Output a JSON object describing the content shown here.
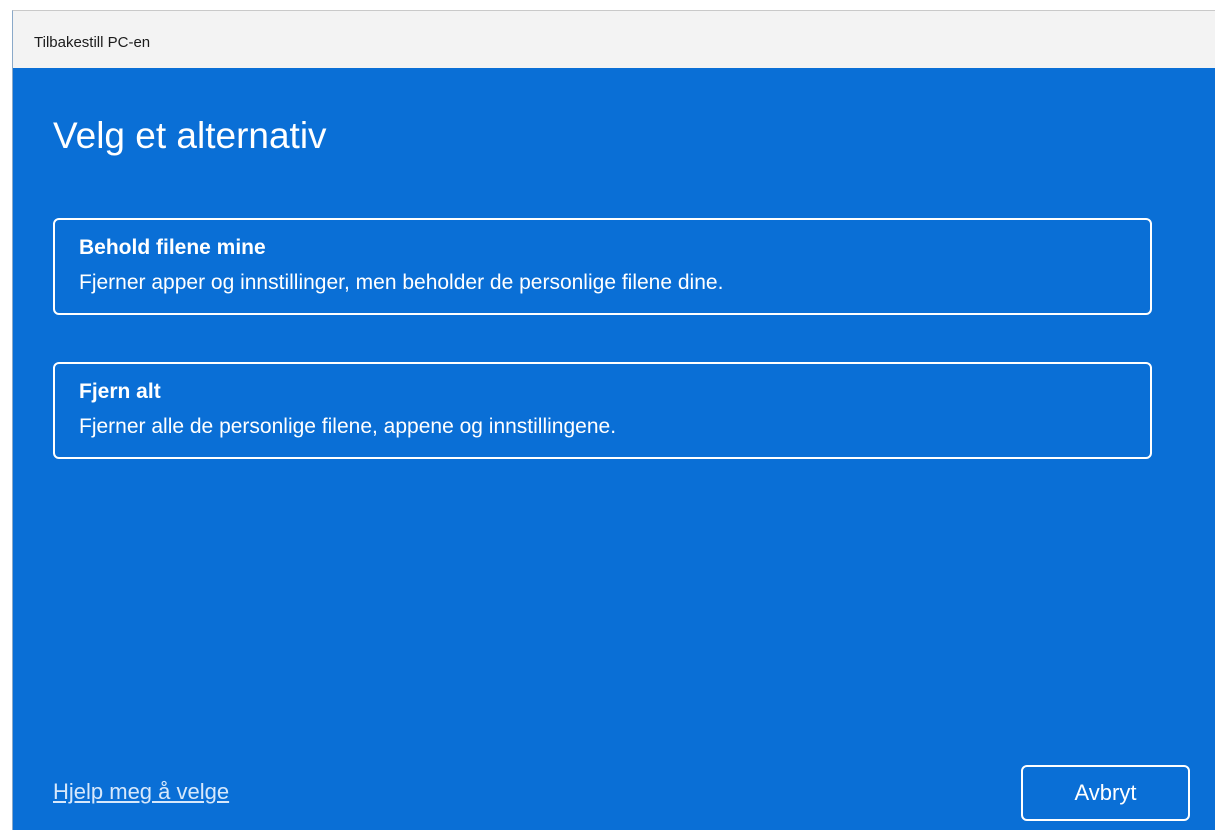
{
  "window": {
    "title": "Tilbakestill PC-en"
  },
  "main": {
    "heading": "Velg et alternativ",
    "options": [
      {
        "title": "Behold filene mine",
        "description": "Fjerner apper og innstillinger, men beholder de personlige filene dine."
      },
      {
        "title": "Fjern alt",
        "description": "Fjerner alle de personlige filene, appene og innstillingene."
      }
    ]
  },
  "footer": {
    "help_link": "Hjelp meg å velge",
    "cancel_label": "Avbryt"
  },
  "colors": {
    "background": "#0a6fd6",
    "titlebar": "#f3f3f3",
    "text": "#ffffff"
  }
}
